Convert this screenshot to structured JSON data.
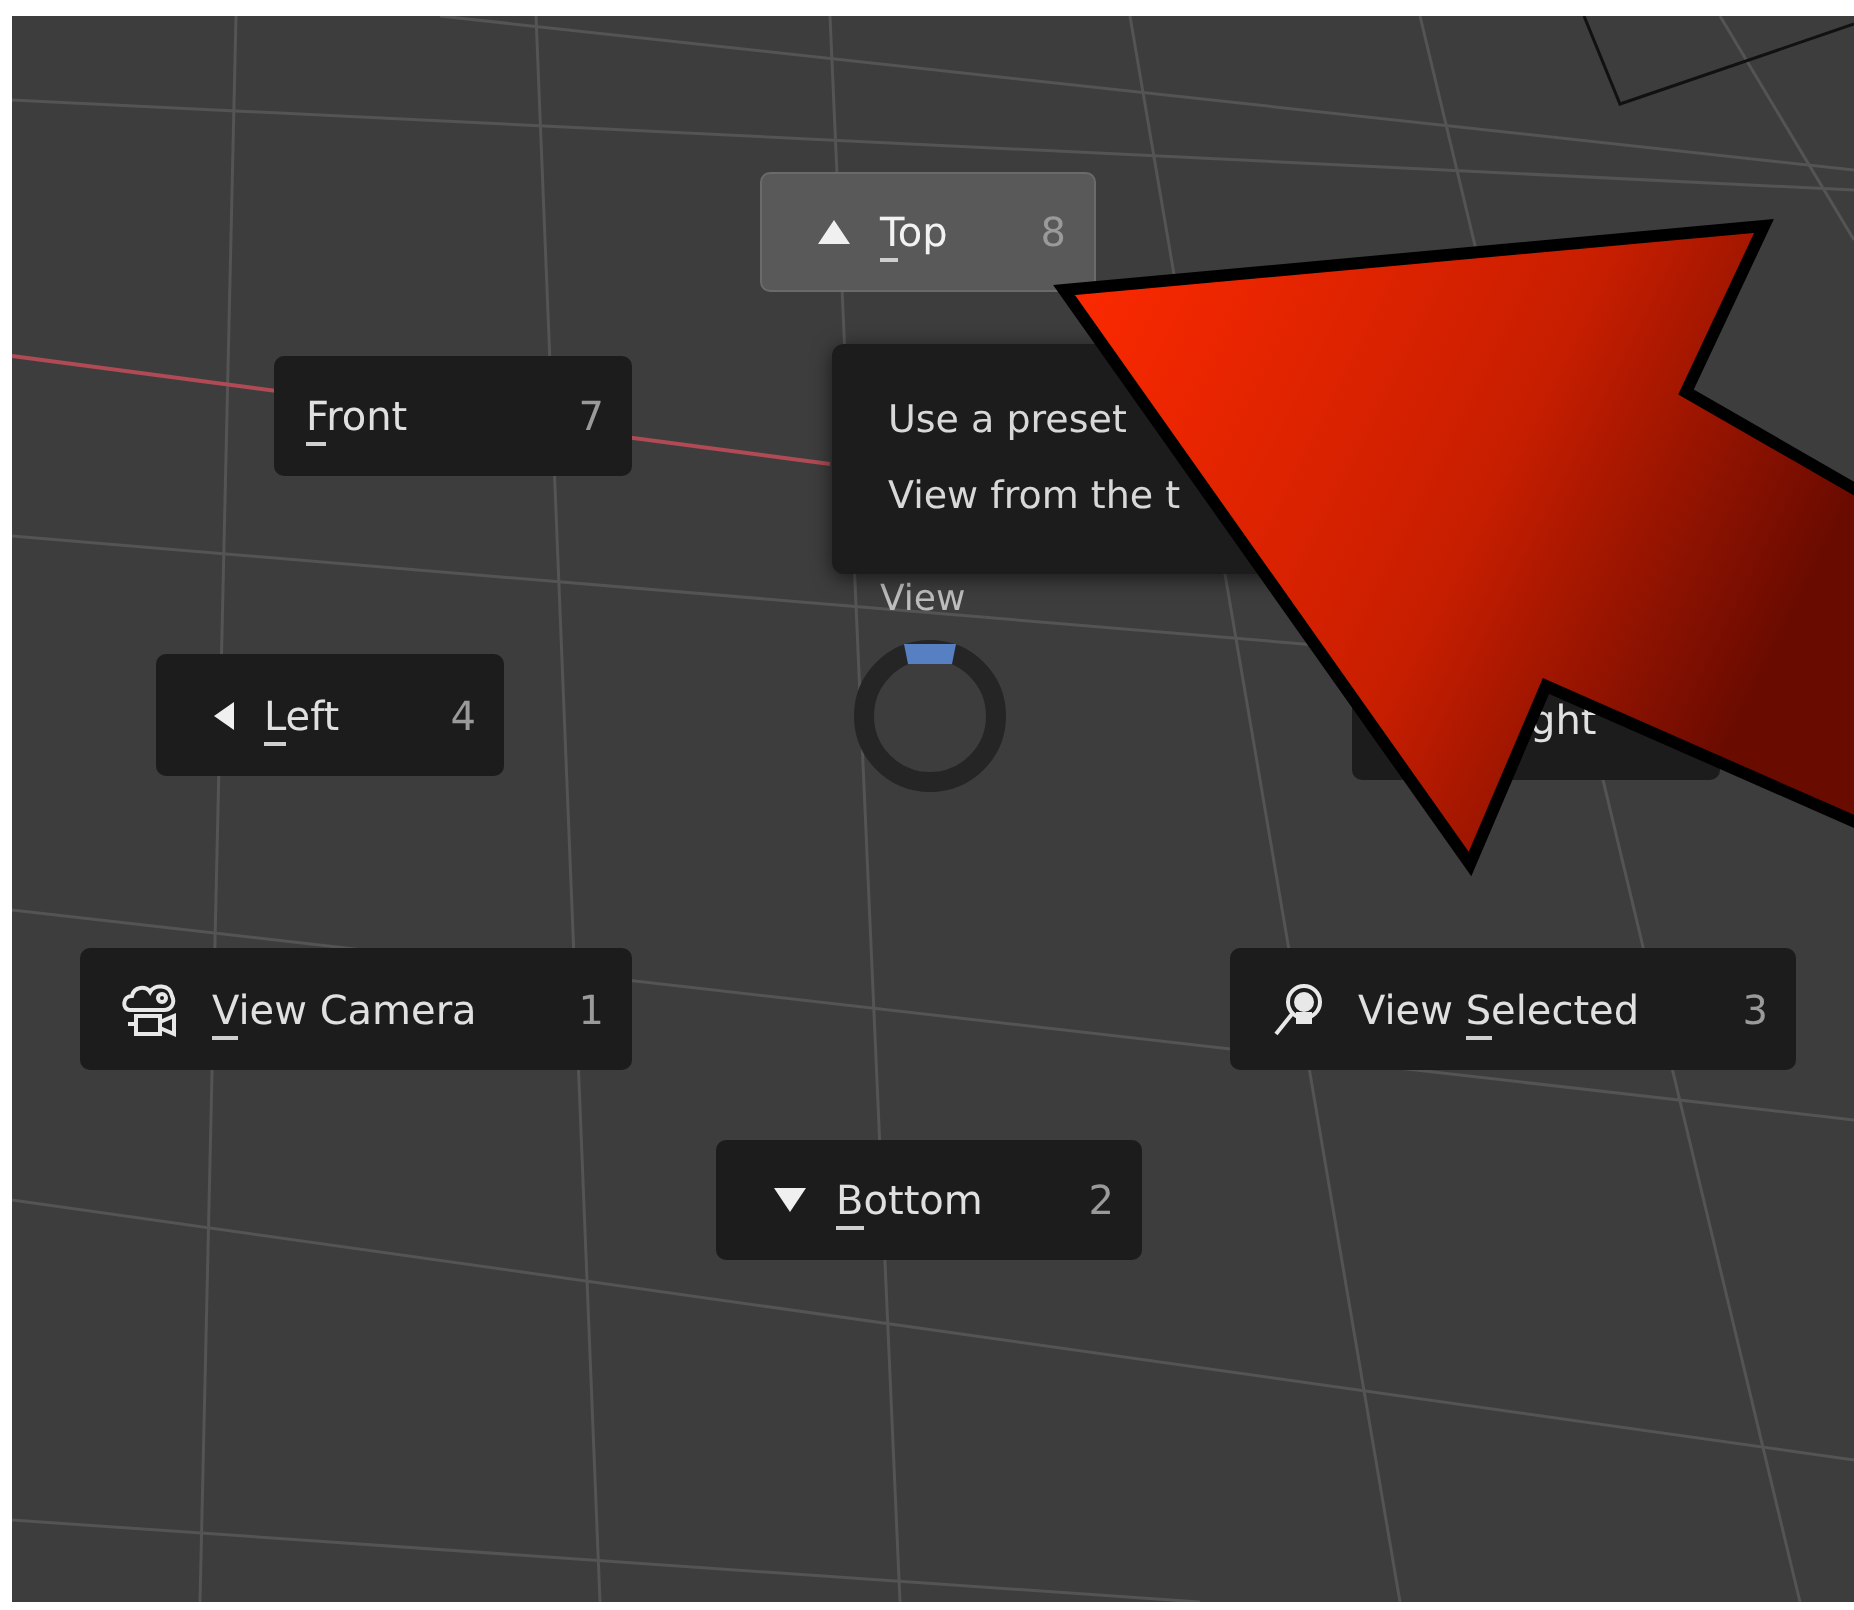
{
  "pie": {
    "title": "View",
    "items": [
      {
        "key": "T",
        "after": "op",
        "hotkey": "8",
        "kind": "triangle-up",
        "selected": true
      },
      {
        "key": "F",
        "after": "ront",
        "hotkey": "7",
        "kind": "plain",
        "selected": false
      },
      {
        "key": "L",
        "after": "eft",
        "hotkey": "4",
        "kind": "triangle-left",
        "selected": false
      },
      {
        "after": "ght",
        "kind": "plain",
        "selected": false
      },
      {
        "key": "V",
        "after": "iew Camera",
        "hotkey": "1",
        "kind": "camera",
        "selected": false
      },
      {
        "before": "View ",
        "key": "S",
        "after": "elected",
        "hotkey": "3",
        "kind": "zoom-selected",
        "selected": false
      },
      {
        "key": "B",
        "after": "ottom",
        "hotkey": "2",
        "kind": "triangle-down",
        "selected": false
      }
    ]
  },
  "tooltip": {
    "lines": [
      "Use a preset",
      "View from the t"
    ]
  }
}
